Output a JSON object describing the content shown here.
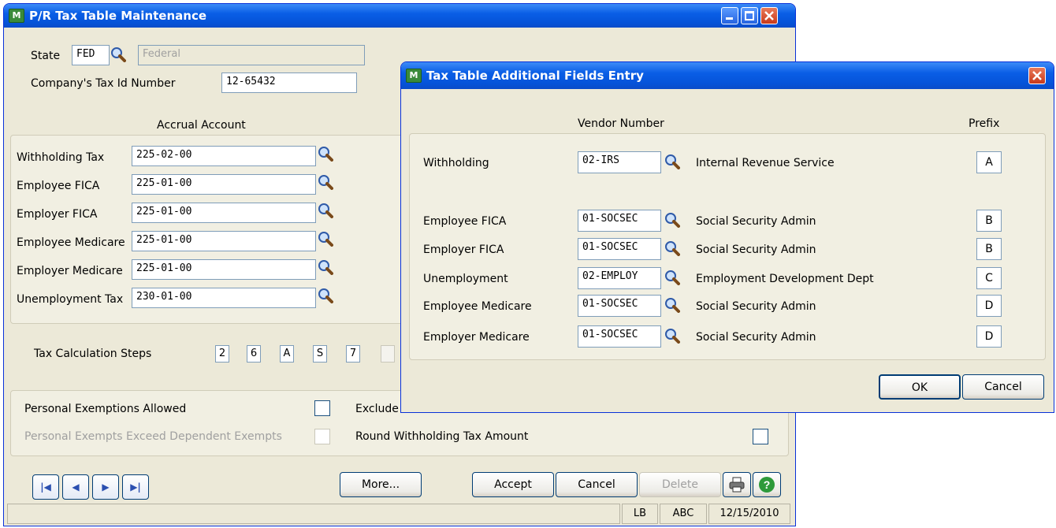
{
  "main": {
    "title": "P/R Tax Table Maintenance",
    "state_label": "State",
    "state_value": "FED",
    "state_name": "Federal",
    "tax_id_label": "Company's Tax Id Number",
    "tax_id_value": "12-65432",
    "accrual_header": "Accrual Account",
    "accounts": [
      {
        "label": "Withholding Tax",
        "value": "225-02-00"
      },
      {
        "label": "Employee FICA",
        "value": "225-01-00"
      },
      {
        "label": "Employer FICA",
        "value": "225-01-00"
      },
      {
        "label": "Employee Medicare",
        "value": "225-01-00"
      },
      {
        "label": "Employer Medicare",
        "value": "225-01-00"
      },
      {
        "label": "Unemployment Tax",
        "value": "230-01-00"
      }
    ],
    "steps_label": "Tax Calculation Steps",
    "steps": [
      "2",
      "6",
      "A",
      "S",
      "7",
      ""
    ],
    "personal_exemptions_label": "Personal Exemptions Allowed",
    "exclude_label": "Exclude",
    "exceed_label": "Personal Exempts Exceed Dependent Exempts",
    "round_label": "Round Withholding Tax Amount",
    "buttons": {
      "more": "More...",
      "accept": "Accept",
      "cancel": "Cancel",
      "delete": "Delete"
    },
    "status": {
      "user": "LB",
      "company": "ABC",
      "date": "12/15/2010"
    }
  },
  "dialog": {
    "title": "Tax Table Additional Fields Entry",
    "vendor_header": "Vendor Number",
    "prefix_header": "Prefix",
    "rows": [
      {
        "label": "Withholding",
        "vendor": "02-IRS",
        "name": "Internal Revenue Service",
        "prefix": "A"
      },
      {
        "label": "Employee FICA",
        "vendor": "01-SOCSEC",
        "name": "Social Security Admin",
        "prefix": "B"
      },
      {
        "label": "Employer FICA",
        "vendor": "01-SOCSEC",
        "name": "Social Security Admin",
        "prefix": "B"
      },
      {
        "label": "Unemployment",
        "vendor": "02-EMPLOY",
        "name": "Employment Development Dept",
        "prefix": "C"
      },
      {
        "label": "Employee Medicare",
        "vendor": "01-SOCSEC",
        "name": "Social Security Admin",
        "prefix": "D"
      },
      {
        "label": "Employer Medicare",
        "vendor": "01-SOCSEC",
        "name": "Social Security Admin",
        "prefix": "D"
      }
    ],
    "ok": "OK",
    "cancel": "Cancel"
  },
  "icons": [
    "app-icon",
    "magnifier-icon",
    "first-record-icon",
    "previous-record-icon",
    "next-record-icon",
    "last-record-icon",
    "printer-icon",
    "help-icon",
    "minimize-icon",
    "maximize-icon",
    "close-icon"
  ]
}
